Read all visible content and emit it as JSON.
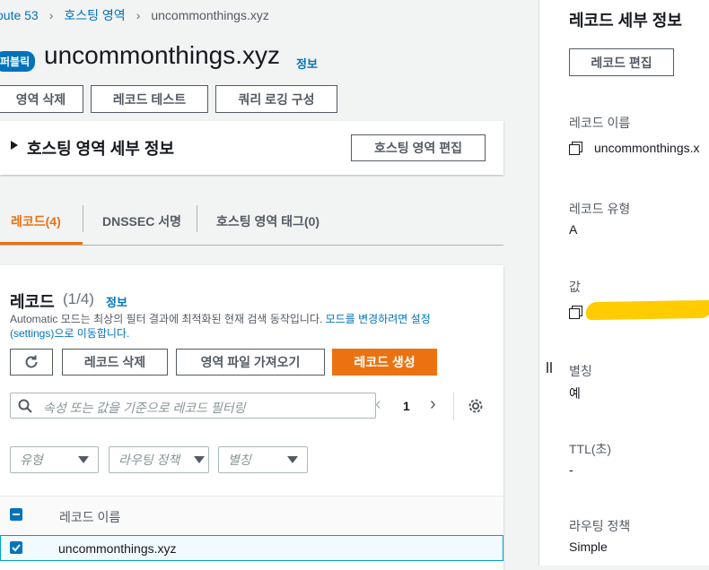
{
  "breadcrumb": {
    "items": [
      "oute 53",
      "호스팅 영역",
      "uncommonthings.xyz"
    ]
  },
  "header": {
    "badge": "퍼블릭",
    "title": "uncommonthings.xyz",
    "info": "정보",
    "buttons": [
      "영역 삭제",
      "레코드 테스트",
      "쿼리 로깅 구성"
    ]
  },
  "hosted_zone_details": {
    "title": "호스팅 영역 세부 정보",
    "edit_button": "호스팅 영역 편집"
  },
  "tabs": [
    {
      "label": "레코드(4)",
      "active": true
    },
    {
      "label": "DNSSEC 서명",
      "active": false
    },
    {
      "label": "호스팅 영역 태그(0)",
      "active": false
    }
  ],
  "records": {
    "title": "레코드",
    "count": "(1/4)",
    "info": "정보",
    "desc_prefix": "Automatic 모드는 최상의 필터 결과에 최적화된 현재 검색 동작입니다. ",
    "desc_link": "모드를 변경하려면 설정 (settings)으로 이동합니다.",
    "delete_button": "레코드 삭제",
    "import_button": "영역 파일 가져오기",
    "create_button": "레코드 생성",
    "search_placeholder": "속성 또는 값을 기준으로 레코드 필터링",
    "page_number": "1",
    "filters": [
      "유형",
      "라우팅 정책",
      "별칭"
    ],
    "column_header": "레코드 이름",
    "rows": [
      {
        "name": "uncommonthings.xyz",
        "checked": true
      }
    ]
  },
  "details_panel": {
    "title": "레코드 세부 정보",
    "edit_button": "레코드 편집",
    "fields": [
      {
        "label": "레코드 이름",
        "value": "uncommonthings.x"
      },
      {
        "label": "레코드 유형",
        "value": "A"
      },
      {
        "label": "값",
        "value": ""
      },
      {
        "label": "별칭",
        "value": "예"
      },
      {
        "label": "TTL(초)",
        "value": "-"
      },
      {
        "label": "라우팅 정책",
        "value": "Simple"
      }
    ],
    "redaction_color": "#ffcc00"
  },
  "colors": {
    "accent": "#ec7211",
    "link": "#0073bb"
  }
}
